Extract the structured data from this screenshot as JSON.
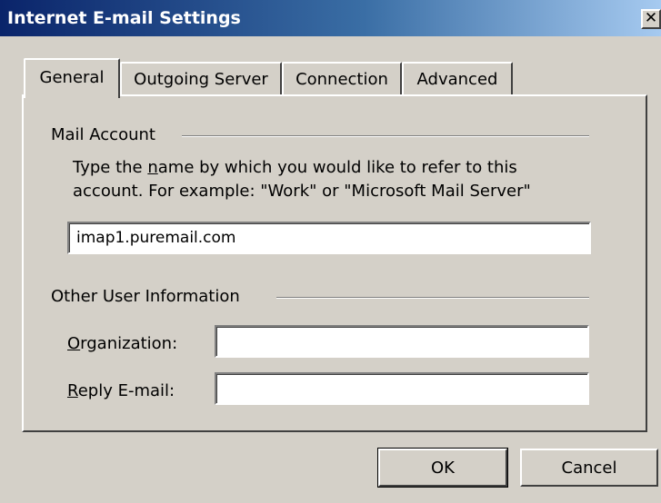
{
  "window": {
    "title": "Internet E-mail Settings",
    "close_glyph": "✕"
  },
  "tabs": [
    {
      "label": "General",
      "active": true
    },
    {
      "label": "Outgoing Server",
      "active": false
    },
    {
      "label": "Connection",
      "active": false
    },
    {
      "label": "Advanced",
      "active": false
    }
  ],
  "mail_account": {
    "heading": "Mail Account",
    "description_line1_pre": "Type the ",
    "description_line1_accel": "n",
    "description_line1_post": "ame by which you would like to refer to this",
    "description_line2": "account.  For example: \"Work\" or \"Microsoft Mail Server\"",
    "account_name_value": "imap1.puremail.com"
  },
  "other_info": {
    "heading": "Other User Information",
    "organization_label_accel": "O",
    "organization_label_rest": "rganization:",
    "organization_value": "",
    "reply_label_accel": "R",
    "reply_label_rest": "eply E-mail:",
    "reply_value": ""
  },
  "buttons": {
    "ok_label": "OK",
    "cancel_label": "Cancel"
  },
  "colors": {
    "titlebar_start": "#0a246a",
    "titlebar_end": "#a6caf0",
    "face": "#d4d0c8"
  }
}
